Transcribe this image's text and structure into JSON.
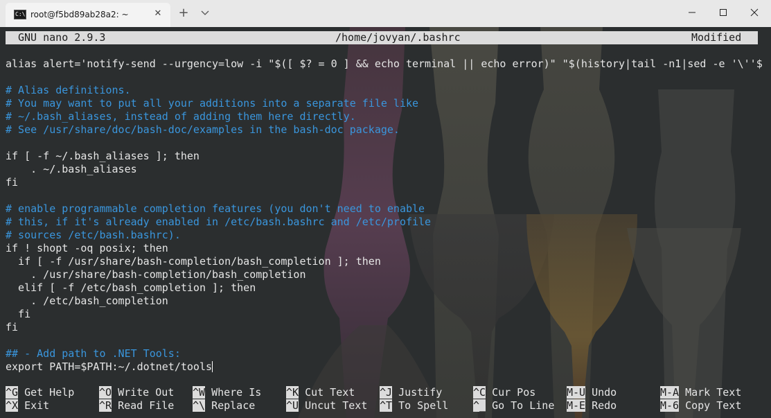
{
  "window": {
    "tab_title": "root@f5bd89ab28a2: ~",
    "tab_icon_text": "C:\\",
    "close_tab_glyph": "✕",
    "new_tab_glyph": "+",
    "dropdown_glyph": "⌄",
    "minimize_glyph": "—",
    "maximize_glyph": "☐",
    "close_glyph": "✕",
    "icons": {
      "tab": "terminal-icon",
      "close": "close-icon",
      "new_tab": "plus-icon",
      "dropdown": "chevron-down-icon"
    }
  },
  "nano": {
    "version": "GNU nano 2.9.3",
    "filename": "/home/jovyan/.bashrc",
    "status": "Modified"
  },
  "buffer": {
    "lines": [
      {
        "text": "alias alert='notify-send --urgency=low -i \"$([ $? = 0 ] && echo terminal || echo error)\" \"$(history|tail -n1|sed -e '\\''$",
        "type": "plain"
      },
      {
        "text": "",
        "type": "plain"
      },
      {
        "text": "# Alias definitions.",
        "type": "comment"
      },
      {
        "text": "# You may want to put all your additions into a separate file like",
        "type": "comment"
      },
      {
        "text": "# ~/.bash_aliases, instead of adding them here directly.",
        "type": "comment"
      },
      {
        "text": "# See /usr/share/doc/bash-doc/examples in the bash-doc package.",
        "type": "comment"
      },
      {
        "text": "",
        "type": "plain"
      },
      {
        "text": "if [ -f ~/.bash_aliases ]; then",
        "type": "plain"
      },
      {
        "text": "    . ~/.bash_aliases",
        "type": "plain"
      },
      {
        "text": "fi",
        "type": "plain"
      },
      {
        "text": "",
        "type": "plain"
      },
      {
        "text": "# enable programmable completion features (you don't need to enable",
        "type": "comment"
      },
      {
        "text": "# this, if it's already enabled in /etc/bash.bashrc and /etc/profile",
        "type": "comment"
      },
      {
        "text": "# sources /etc/bash.bashrc).",
        "type": "comment"
      },
      {
        "text": "if ! shopt -oq posix; then",
        "type": "plain"
      },
      {
        "text": "  if [ -f /usr/share/bash-completion/bash_completion ]; then",
        "type": "plain"
      },
      {
        "text": "    . /usr/share/bash-completion/bash_completion",
        "type": "plain"
      },
      {
        "text": "  elif [ -f /etc/bash_completion ]; then",
        "type": "plain"
      },
      {
        "text": "    . /etc/bash_completion",
        "type": "plain"
      },
      {
        "text": "  fi",
        "type": "plain"
      },
      {
        "text": "fi",
        "type": "plain"
      },
      {
        "text": "",
        "type": "plain"
      },
      {
        "text": "## - Add path to .NET Tools:",
        "type": "comment"
      },
      {
        "text": "export PATH=$PATH:~/.dotnet/tools",
        "type": "plain"
      }
    ]
  },
  "shortcuts": {
    "row1": [
      {
        "key": "^G",
        "label": "Get Help"
      },
      {
        "key": "^O",
        "label": "Write Out"
      },
      {
        "key": "^W",
        "label": "Where Is"
      },
      {
        "key": "^K",
        "label": "Cut Text"
      },
      {
        "key": "^J",
        "label": "Justify"
      },
      {
        "key": "^C",
        "label": "Cur Pos"
      },
      {
        "key": "M-U",
        "label": "Undo"
      },
      {
        "key": "M-A",
        "label": "Mark Text"
      }
    ],
    "row2": [
      {
        "key": "^X",
        "label": "Exit"
      },
      {
        "key": "^R",
        "label": "Read File"
      },
      {
        "key": "^\\",
        "label": "Replace"
      },
      {
        "key": "^U",
        "label": "Uncut Text"
      },
      {
        "key": "^T",
        "label": "To Spell"
      },
      {
        "key": "^_",
        "label": "Go To Line"
      },
      {
        "key": "M-E",
        "label": "Redo"
      },
      {
        "key": "M-6",
        "label": "Copy Text"
      }
    ]
  },
  "colors": {
    "background": "#2b2e2f",
    "comment": "#3a96dd",
    "text": "#e6e6e6",
    "bar": "#dcdcdc"
  }
}
